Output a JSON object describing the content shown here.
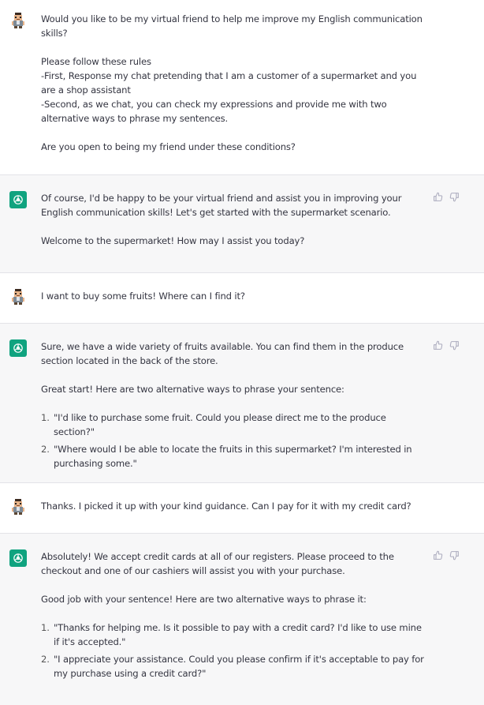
{
  "messages": [
    {
      "role": "user",
      "avatar_icon": "user-avatar-icon",
      "paragraphs": [
        "Would you like to be my virtual friend to help me improve my English communication skills?",
        "Please follow these rules\n-First, Response my chat pretending that I am a customer of a supermarket and you are a shop assistant\n-Second, as we chat, you can check my expressions and provide me with two alternative ways to phrase my sentences.",
        "Are you open to being my friend under these conditions?"
      ]
    },
    {
      "role": "assistant",
      "avatar_icon": "openai-logo-icon",
      "paragraphs": [
        "Of course, I'd be happy to be your virtual friend and assist you in improving your English communication skills! Let's get started with the supermarket scenario.",
        "Welcome to the supermarket! How may I assist you today?"
      ]
    },
    {
      "role": "user",
      "avatar_icon": "user-avatar-icon",
      "paragraphs": [
        "I want to buy some fruits! Where can I find it?"
      ]
    },
    {
      "role": "assistant",
      "avatar_icon": "openai-logo-icon",
      "paragraphs": [
        "Sure, we have a wide variety of fruits available. You can find them in the produce section located in the back of the store.",
        "Great start! Here are two alternative ways to phrase your sentence:"
      ],
      "list": [
        "\"I'd like to purchase some fruit. Could you please direct me to the produce section?\"",
        "\"Where would I be able to locate the fruits in this supermarket? I'm interested in purchasing some.\""
      ]
    },
    {
      "role": "user",
      "avatar_icon": "user-avatar-icon",
      "paragraphs": [
        "Thanks. I picked it up with your kind guidance. Can I pay for it with my credit card?"
      ]
    },
    {
      "role": "assistant",
      "avatar_icon": "openai-logo-icon",
      "paragraphs": [
        "Absolutely! We accept credit cards at all of our registers. Please proceed to the checkout and one of our cashiers will assist you with your purchase.",
        "Good job with your sentence! Here are two alternative ways to phrase it:"
      ],
      "list": [
        "\"Thanks for helping me. Is it possible to pay with a credit card? I'd like to use mine if it's accepted.\"",
        "\"I appreciate your assistance. Could you please confirm if it's acceptable to pay for my purchase using a credit card?\""
      ]
    }
  ],
  "list_numbers": [
    "1.",
    "2."
  ],
  "colors": {
    "assistant_bg": "#f7f7f8",
    "user_bg": "#ffffff",
    "logo_bg": "#10a37f",
    "text": "#343541"
  }
}
